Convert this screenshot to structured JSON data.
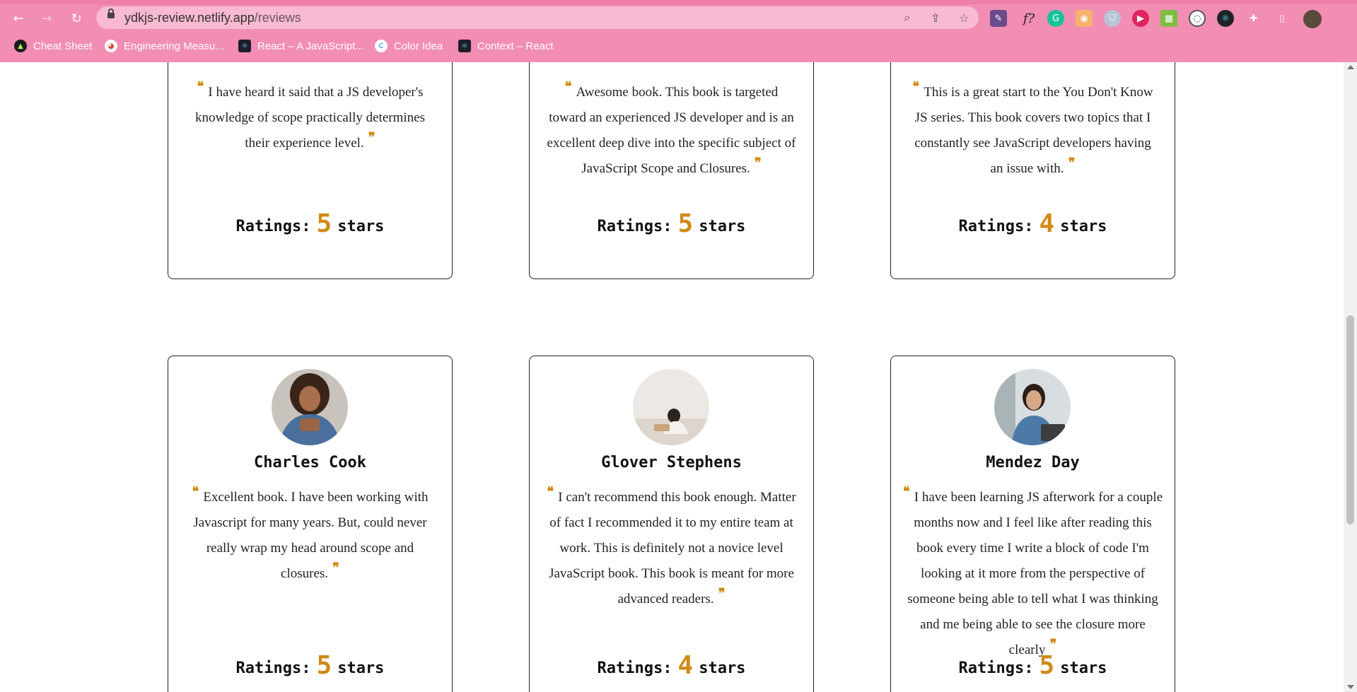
{
  "browser": {
    "url_host": "ydkjs-review.netlify.app",
    "url_path": "/reviews",
    "bookmarks": [
      {
        "label": "Cheat Sheet",
        "icon": "cheat-sheet-favicon"
      },
      {
        "label": "Engineering Measu...",
        "icon": "chrome-favicon"
      },
      {
        "label": "React – A JavaScript...",
        "icon": "react-favicon"
      },
      {
        "label": "Color Idea",
        "icon": "color-idea-favicon"
      },
      {
        "label": "Context – React",
        "icon": "react-favicon"
      }
    ],
    "extensions_label": "f?"
  },
  "colors": {
    "accent": "#d18a16",
    "chrome": "#f28db4",
    "omnibox": "#f8b9d2"
  },
  "reviews_top": [
    {
      "quote": "I have heard it said that a JS developer's knowledge of scope practically determines their experience level.",
      "ratings_label": "Ratings:",
      "rating": "5",
      "stars_label": "stars"
    },
    {
      "quote": "Awesome book. This book is targeted toward an experienced JS developer and is an excellent deep dive into the specific subject of JavaScript Scope and Closures.",
      "ratings_label": "Ratings:",
      "rating": "5",
      "stars_label": "stars"
    },
    {
      "quote": "This is a great start to the You Don't Know JS series. This book covers two topics that I constantly see JavaScript developers having an issue with.",
      "ratings_label": "Ratings:",
      "rating": "4",
      "stars_label": "stars"
    }
  ],
  "reviews_bottom": [
    {
      "name": "Charles Cook",
      "quote": "Excellent book. I have been working with Javascript for many years. But, could never really wrap my head around scope and closures.",
      "ratings_label": "Ratings:",
      "rating": "5",
      "stars_label": "stars"
    },
    {
      "name": "Glover Stephens",
      "quote": "I can't recommend this book enough. Matter of fact I recommended it to my entire team at work. This is definitely not a novice level JavaScript book. This book is meant for more advanced readers.",
      "ratings_label": "Ratings:",
      "rating": "4",
      "stars_label": "stars"
    },
    {
      "name": "Mendez Day",
      "quote": "I have been learning JS afterwork for a couple months now and I feel like after reading this book every time I write a block of code I'm looking at it more from the perspective of someone being able to tell what I was thinking and me being able to see the closure more clearly",
      "ratings_label": "Ratings:",
      "rating": "5",
      "stars_label": "stars"
    }
  ]
}
